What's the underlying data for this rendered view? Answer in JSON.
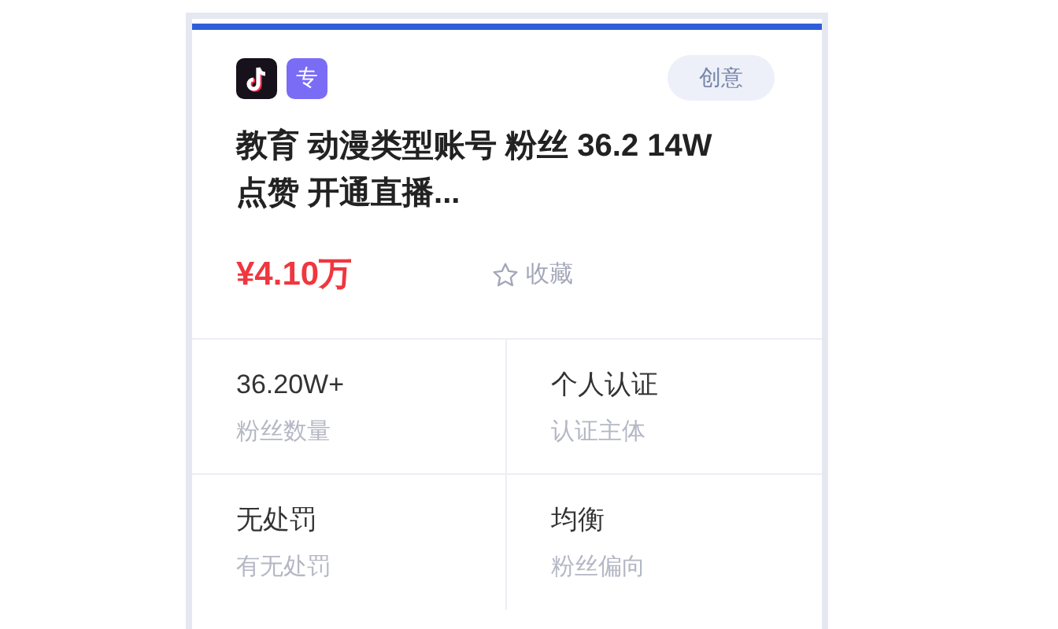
{
  "card": {
    "platform_badge": "专",
    "tag": "创意",
    "title": "教育 动漫类型账号 粉丝 36.2 14W点赞 开通直播...",
    "price": "¥4.10万",
    "favorite": "收藏",
    "stats": [
      {
        "value": "36.20W+",
        "label": "粉丝数量"
      },
      {
        "value": "个人认证",
        "label": "认证主体"
      },
      {
        "value": "无处罚",
        "label": "有无处罚"
      },
      {
        "value": "均衡",
        "label": "粉丝偏向"
      }
    ]
  }
}
